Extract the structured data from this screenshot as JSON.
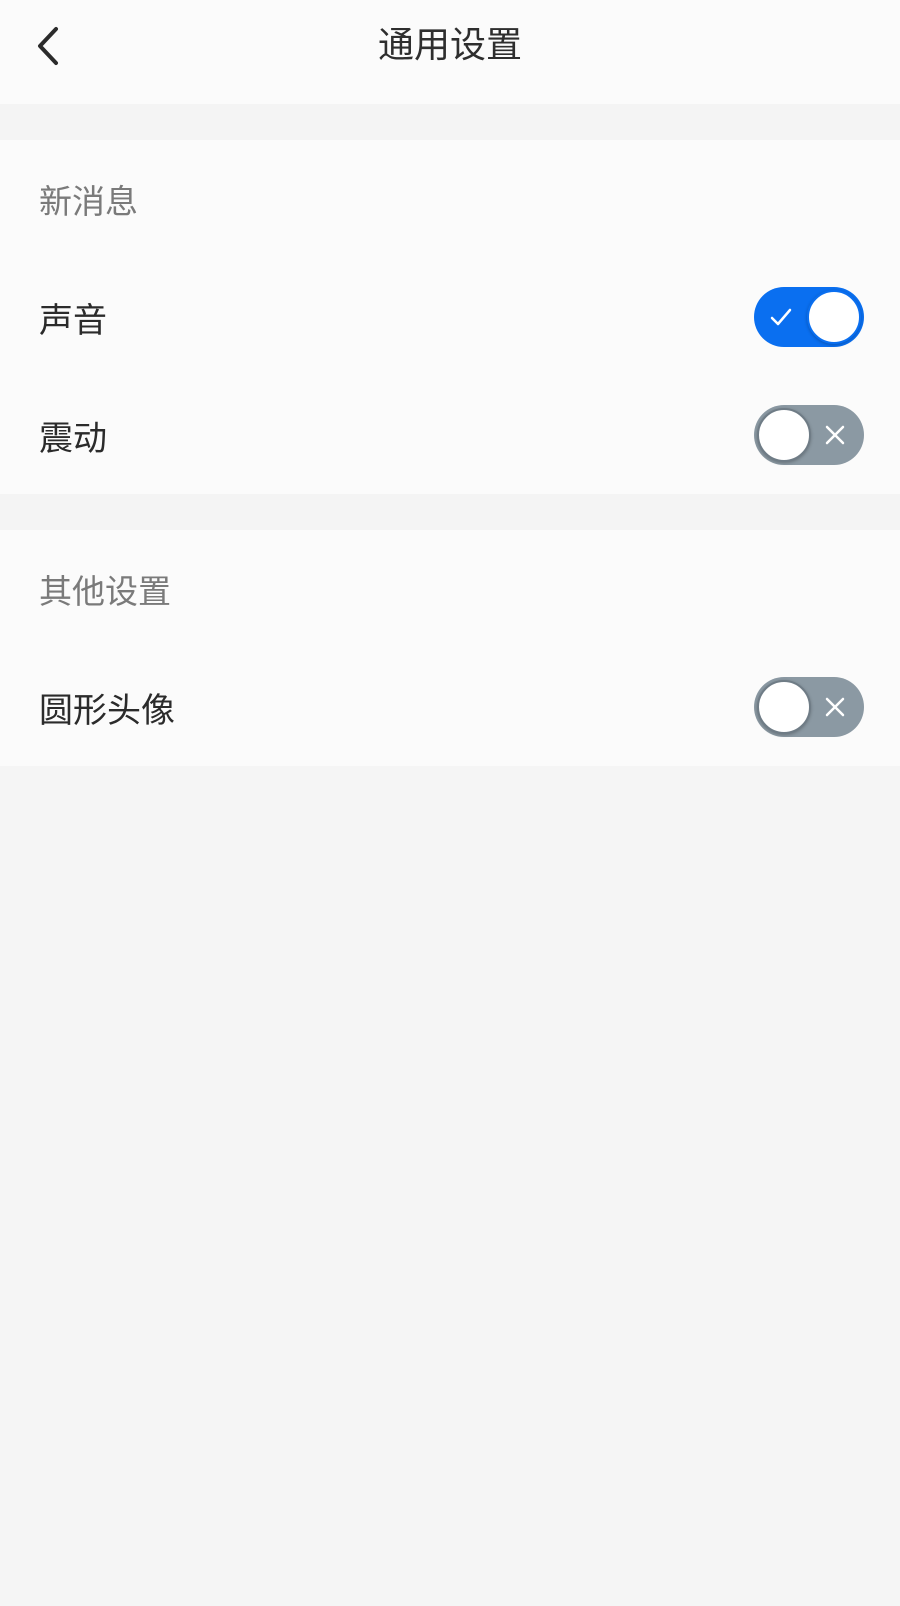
{
  "header": {
    "title": "通用设置",
    "back_icon": "chevron-left-icon"
  },
  "sections": [
    {
      "title": "新消息",
      "rows": [
        {
          "label": "声音",
          "toggle": {
            "state": "on",
            "color": "#0a6ff0"
          }
        },
        {
          "label": "震动",
          "toggle": {
            "state": "off",
            "color": "#8b99a3"
          }
        }
      ]
    },
    {
      "title": "其他设置",
      "rows": [
        {
          "label": "圆形头像",
          "toggle": {
            "state": "off",
            "color": "#8b99a3"
          }
        }
      ]
    }
  ]
}
